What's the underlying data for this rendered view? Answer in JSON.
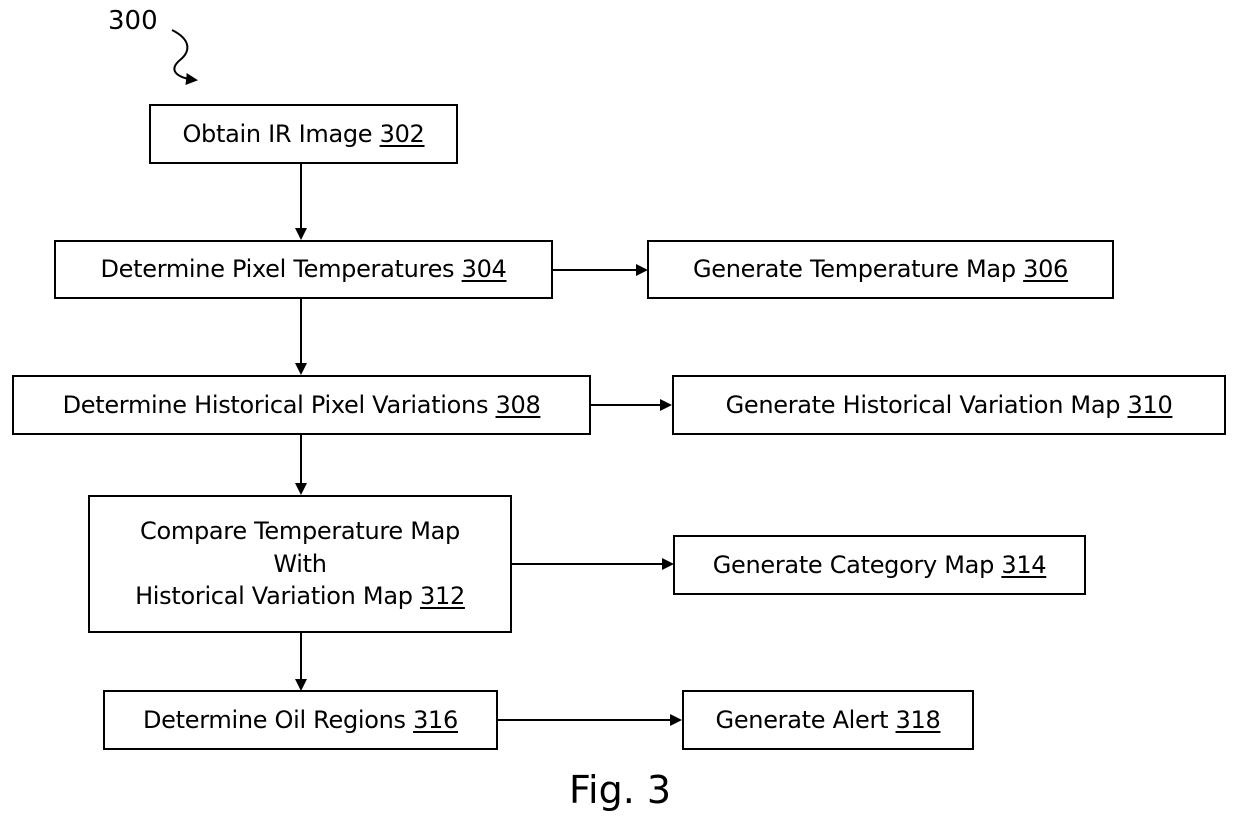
{
  "diagram": {
    "reference_label": "300",
    "figure_caption": "Fig. 3",
    "steps": [
      {
        "id": "302",
        "text": "Obtain IR Image ",
        "ref": "302"
      },
      {
        "id": "304",
        "text": "Determine Pixel Temperatures ",
        "ref": "304"
      },
      {
        "id": "306",
        "text": "Generate Temperature Map ",
        "ref": "306"
      },
      {
        "id": "308",
        "text": "Determine Historical Pixel Variations ",
        "ref": "308"
      },
      {
        "id": "310",
        "text": "Generate Historical Variation Map ",
        "ref": "310"
      },
      {
        "id": "312",
        "lines": [
          "Compare Temperature Map",
          "With",
          "Historical Variation Map "
        ],
        "ref": "312"
      },
      {
        "id": "314",
        "text": "Generate Category Map ",
        "ref": "314"
      },
      {
        "id": "316",
        "text": "Determine Oil Regions ",
        "ref": "316"
      },
      {
        "id": "318",
        "text": "Generate Alert ",
        "ref": "318"
      }
    ],
    "edges": [
      [
        "302",
        "304"
      ],
      [
        "304",
        "306"
      ],
      [
        "304",
        "308"
      ],
      [
        "308",
        "310"
      ],
      [
        "308",
        "312"
      ],
      [
        "312",
        "314"
      ],
      [
        "312",
        "316"
      ],
      [
        "316",
        "318"
      ]
    ]
  }
}
